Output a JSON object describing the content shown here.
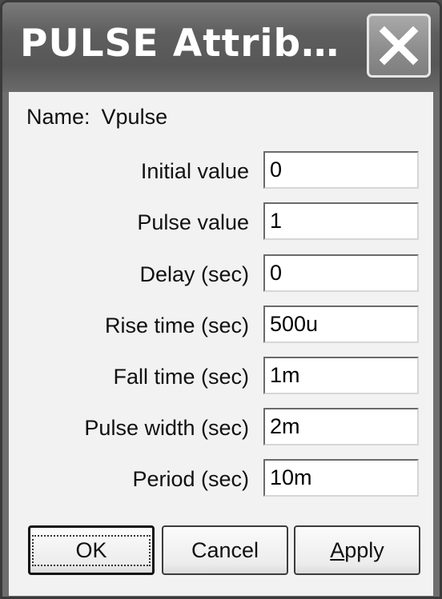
{
  "window": {
    "title": "PULSE Attrib…"
  },
  "name_row": {
    "label": "Name:",
    "value": "Vpulse"
  },
  "fields": [
    {
      "label": "Initial value",
      "value": "0"
    },
    {
      "label": "Pulse value",
      "value": "1"
    },
    {
      "label": "Delay (sec)",
      "value": "0"
    },
    {
      "label": "Rise time (sec)",
      "value": "500u"
    },
    {
      "label": "Fall time (sec)",
      "value": "1m"
    },
    {
      "label": "Pulse width (sec)",
      "value": "2m"
    },
    {
      "label": "Period (sec)",
      "value": "10m"
    }
  ],
  "buttons": {
    "ok": "OK",
    "cancel": "Cancel",
    "apply": "Apply"
  },
  "icons": {
    "close": "close-icon"
  }
}
